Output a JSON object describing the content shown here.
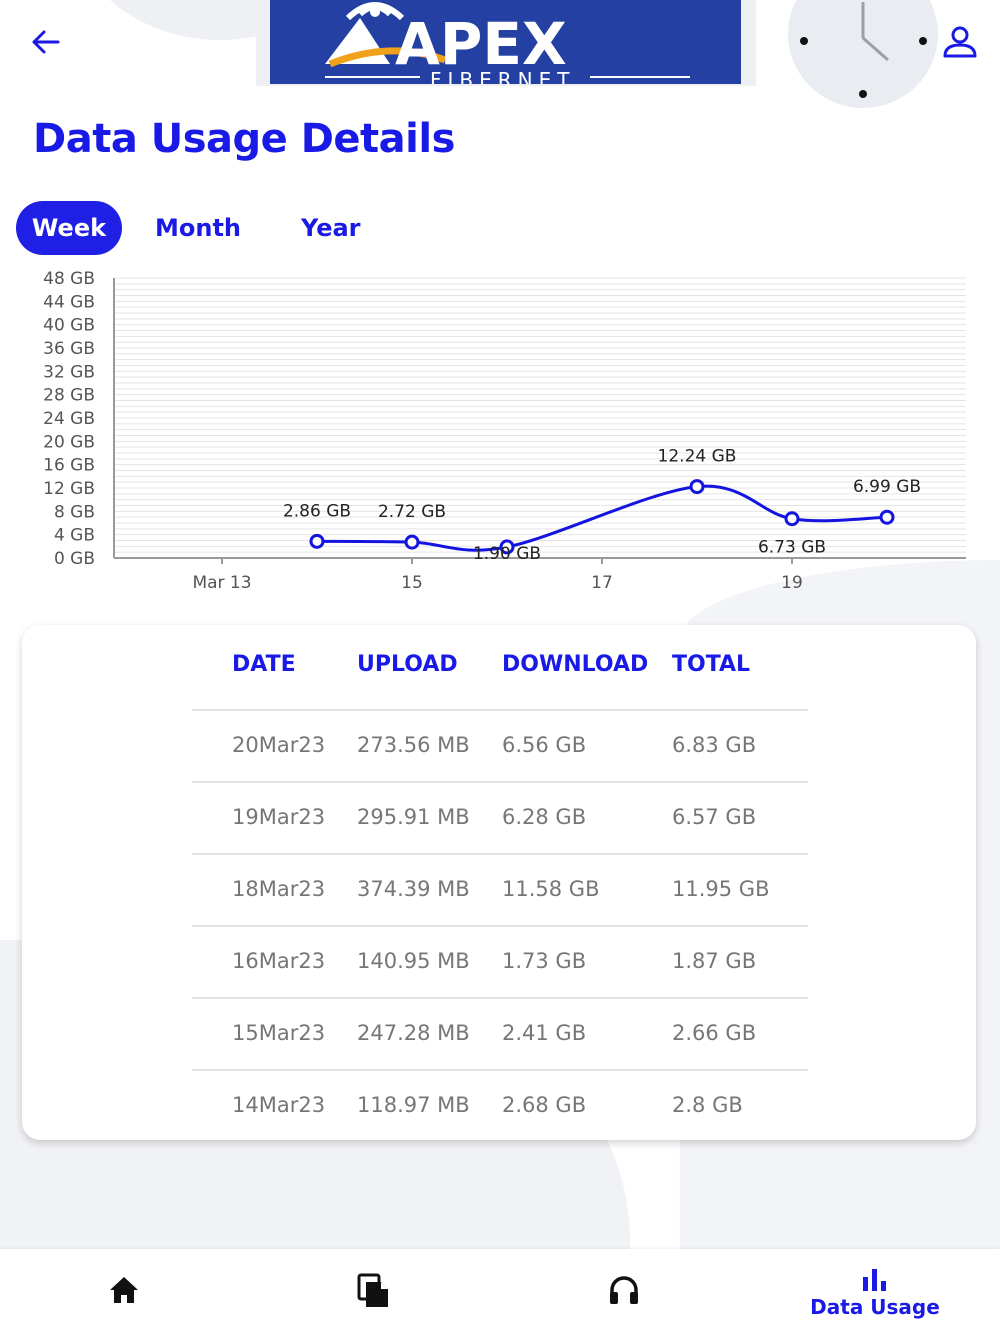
{
  "header": {
    "back_icon": "arrow-left-icon",
    "logo_text": "APEX",
    "logo_subtext": "FIBERNET",
    "profile_icon": "person-icon",
    "title": "Data Usage Details"
  },
  "tabs": [
    {
      "label": "Week",
      "active": true
    },
    {
      "label": "Month",
      "active": false
    },
    {
      "label": "Year",
      "active": false
    }
  ],
  "colors": {
    "accent": "#1a1ae6",
    "line": "#1414e0",
    "logo_bg": "#2340a2",
    "logo_orange": "#f2a21a",
    "cell_text": "#767676"
  },
  "chart_data": {
    "type": "line",
    "y_tick_labels": [
      "48 GB",
      "44 GB",
      "40 GB",
      "36 GB",
      "32 GB",
      "28 GB",
      "24 GB",
      "20 GB",
      "16 GB",
      "12 GB",
      "8 GB",
      "4 GB",
      "0 GB"
    ],
    "x_tick_labels": [
      "Mar 13",
      "15",
      "17",
      "19"
    ],
    "ylim": [
      0,
      48
    ],
    "points": [
      {
        "day": 14,
        "value": 2.86,
        "label": "2.86 GB"
      },
      {
        "day": 15,
        "value": 2.72,
        "label": "2.72 GB"
      },
      {
        "day": 16,
        "value": 1.9,
        "label": "1.90 GB"
      },
      {
        "day": 18,
        "value": 12.24,
        "label": "12.24 GB"
      },
      {
        "day": 19,
        "value": 6.73,
        "label": "6.73 GB"
      },
      {
        "day": 20,
        "value": 6.99,
        "label": "6.99 GB"
      }
    ],
    "grid": true
  },
  "table": {
    "headers": [
      "DATE",
      "UPLOAD",
      "DOWNLOAD",
      "TOTAL"
    ],
    "rows": [
      [
        "20Mar23",
        "273.56 MB",
        "6.56 GB",
        "6.83 GB"
      ],
      [
        "19Mar23",
        "295.91 MB",
        "6.28 GB",
        "6.57 GB"
      ],
      [
        "18Mar23",
        "374.39 MB",
        "11.58 GB",
        "11.95 GB"
      ],
      [
        "16Mar23",
        "140.95 MB",
        "1.73 GB",
        "1.87 GB"
      ],
      [
        "15Mar23",
        "247.28 MB",
        "2.41 GB",
        "2.66 GB"
      ],
      [
        "14Mar23",
        "118.97 MB",
        "2.68 GB",
        "2.8 GB"
      ]
    ]
  },
  "bottom_nav": [
    {
      "icon": "home-icon"
    },
    {
      "icon": "documents-icon"
    },
    {
      "icon": "headphones-icon"
    },
    {
      "icon": "bar-chart-icon",
      "label": "Data Usage",
      "active": true
    }
  ]
}
